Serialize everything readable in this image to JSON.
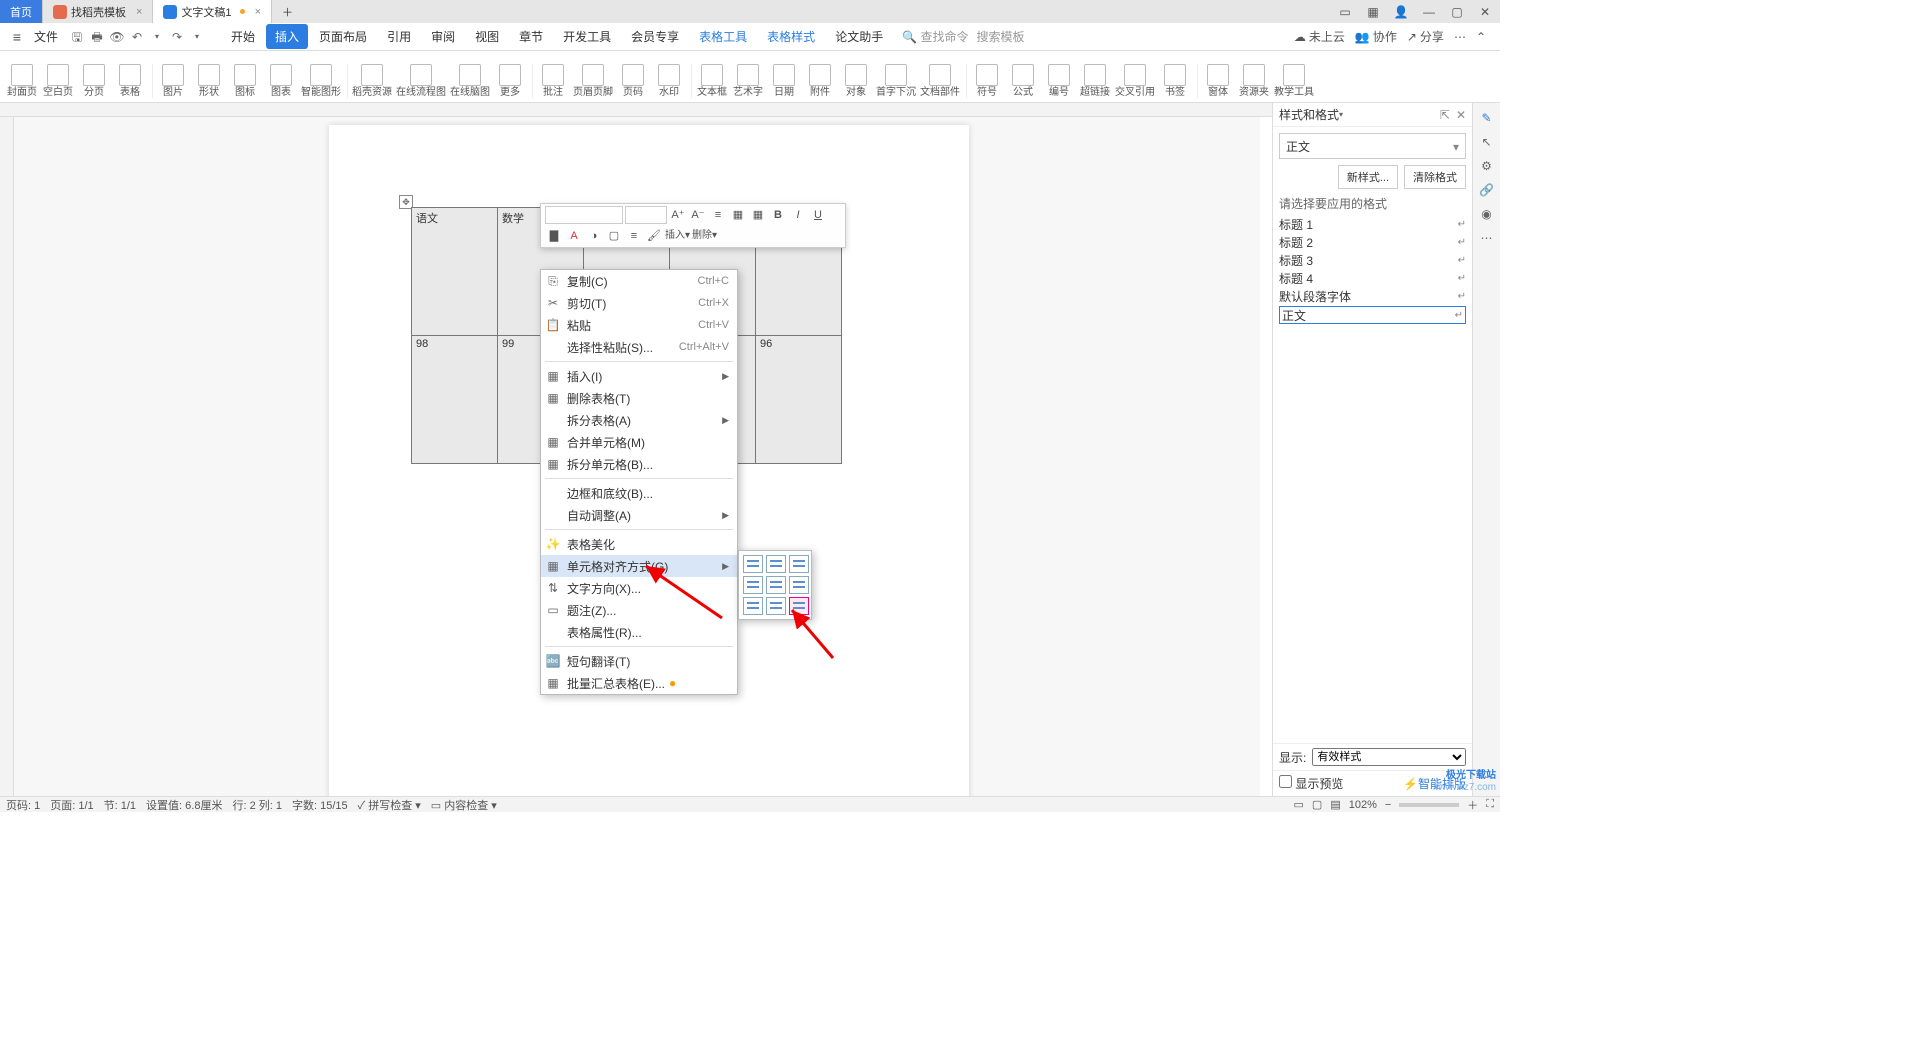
{
  "tabs": {
    "home": "首页",
    "tpl": "找稻壳模板",
    "doc": "文字文稿1"
  },
  "file_label": "文件",
  "menutabs": [
    "开始",
    "插入",
    "页面布局",
    "引用",
    "审阅",
    "视图",
    "章节",
    "开发工具",
    "会员专享",
    "表格工具",
    "表格样式",
    "论文助手"
  ],
  "menu_selected_idx": 1,
  "menu_link_idx": [
    9,
    10
  ],
  "search": {
    "cmd": "查找命令",
    "tpl": "搜索模板"
  },
  "topright": {
    "cloud": "未上云",
    "coop": "协作",
    "share": "分享"
  },
  "ribbon_groups": [
    [
      "封面页",
      "空白页",
      "分页",
      "表格"
    ],
    [
      "图片",
      "形状",
      "图标",
      "图表",
      "智能图形"
    ],
    [
      "稻壳资源",
      "在线流程图",
      "在线脑图",
      "更多"
    ],
    [
      "批注",
      "页眉页脚",
      "页码",
      "水印"
    ],
    [
      "文本框",
      "艺术字",
      "日期",
      "附件",
      "对象",
      "首字下沉",
      "文档部件"
    ],
    [
      "符号",
      "公式",
      "编号",
      "超链接",
      "交叉引用",
      "书签"
    ],
    [
      "窗体",
      "资源夹",
      "教学工具"
    ]
  ],
  "table": {
    "headers": [
      "语文",
      "数学",
      "",
      "",
      ""
    ],
    "row2": [
      "98",
      "99",
      "",
      "",
      "96"
    ]
  },
  "minitb": {
    "btns": [
      "B",
      "I",
      "U",
      "A",
      "A",
      "A",
      "A"
    ],
    "ops": [
      "插入",
      "删除"
    ]
  },
  "ctx": [
    {
      "t": "复制(C)",
      "s": "Ctrl+C",
      "i": "⎘"
    },
    {
      "t": "剪切(T)",
      "s": "Ctrl+X",
      "i": "✂"
    },
    {
      "t": "粘贴",
      "s": "Ctrl+V",
      "i": "📋"
    },
    {
      "t": "选择性粘贴(S)...",
      "s": "Ctrl+Alt+V"
    },
    {
      "sep": true
    },
    {
      "t": "插入(I)",
      "arr": true,
      "i": "▦"
    },
    {
      "t": "删除表格(T)",
      "i": "▦"
    },
    {
      "t": "拆分表格(A)",
      "arr": true
    },
    {
      "t": "合并单元格(M)",
      "i": "▦"
    },
    {
      "t": "拆分单元格(B)...",
      "i": "▦"
    },
    {
      "sep": true
    },
    {
      "t": "边框和底纹(B)..."
    },
    {
      "t": "自动调整(A)",
      "arr": true
    },
    {
      "sep": true
    },
    {
      "t": "表格美化",
      "i": "✨"
    },
    {
      "t": "单元格对齐方式(G)",
      "arr": true,
      "hi": true,
      "i": "▦"
    },
    {
      "t": "文字方向(X)...",
      "i": "⇅"
    },
    {
      "t": "题注(Z)...",
      "i": "▭"
    },
    {
      "t": "表格属性(R)..."
    },
    {
      "sep": true
    },
    {
      "t": "短句翻译(T)",
      "i": "🔤"
    },
    {
      "t": "批量汇总表格(E)...",
      "i": "▦",
      "badge": true
    }
  ],
  "rpanel": {
    "title": "样式和格式",
    "current": "正文",
    "btns": [
      "新样式...",
      "清除格式"
    ],
    "hint": "请选择要应用的格式",
    "items": [
      "标题 1",
      "标题 2",
      "标题 3",
      "标题 4",
      "默认段落字体",
      "正文"
    ],
    "sel_idx": 5,
    "show_lbl": "显示:",
    "show_val": "有效样式",
    "preview": "显示预览",
    "smart": "智能排版"
  },
  "status": {
    "page": "页码: 1",
    "pages": "页面: 1/1",
    "sect": "节: 1/1",
    "setv": "设置值: 6.8厘米",
    "rc": "行: 2  列: 1",
    "chars": "字数: 15/15",
    "spell": "拼写检查",
    "content": "内容检查",
    "zoom": "102%"
  },
  "wm": {
    "l1": "极光下载站",
    "l2": "www.xz7.com"
  }
}
